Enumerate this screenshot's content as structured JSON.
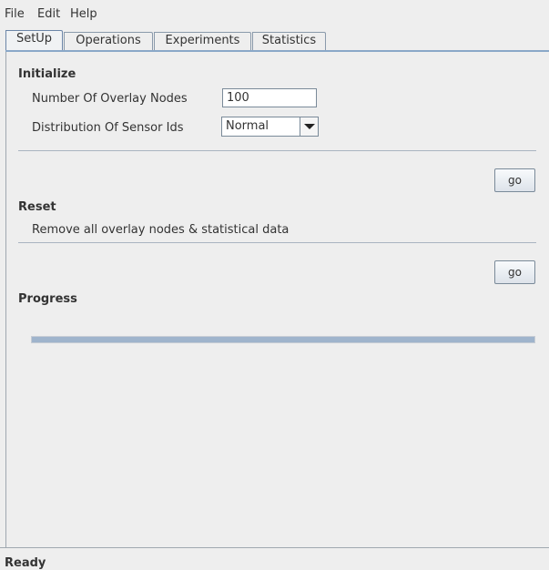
{
  "menu": {
    "file": "File",
    "edit": "Edit",
    "help": "Help"
  },
  "tabs": [
    {
      "label": "SetUp"
    },
    {
      "label": "Operations"
    },
    {
      "label": "Experiments"
    },
    {
      "label": "Statistics"
    }
  ],
  "initialize": {
    "heading": "Initialize",
    "overlay_nodes_label": "Number Of Overlay Nodes",
    "overlay_nodes_value": "100",
    "distribution_label": "Distribution Of Sensor Ids",
    "distribution_value": "Normal",
    "go_label": "go"
  },
  "reset": {
    "heading": "Reset",
    "description": "Remove all overlay nodes & statistical data",
    "go_label": "go"
  },
  "progress": {
    "heading": "Progress",
    "value": 1.0
  },
  "status": {
    "text": "Ready"
  },
  "colors": {
    "accent": "#8aa8c8",
    "progress_fill": "#9fb4cc"
  }
}
